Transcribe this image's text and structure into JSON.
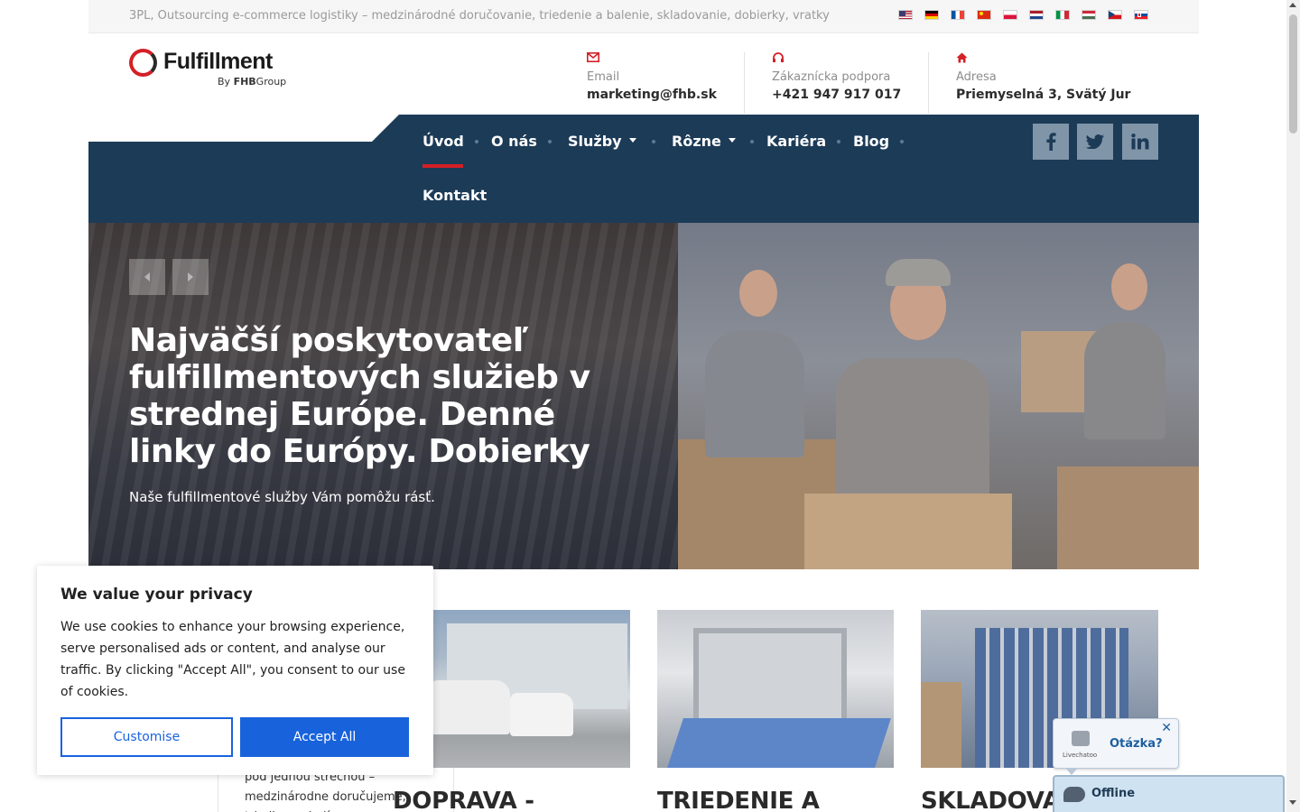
{
  "topbar": {
    "tagline": "3PL, Outsourcing e-commerce logistiky – medzinárodné doručovanie, triedenie a balenie, skladovanie, dobierky, vratky",
    "languages": [
      "en",
      "de",
      "fr",
      "zh",
      "pl",
      "nl",
      "it",
      "hu",
      "cs",
      "sk"
    ]
  },
  "logo": {
    "word": "Fulfillment",
    "by": "By",
    "group_bold": "FHB",
    "group": "Group"
  },
  "contacts": [
    {
      "icon": "envelope-icon",
      "label": "Email",
      "value": "marketing@fhb.sk"
    },
    {
      "icon": "headset-icon",
      "label": "Zákaznícka podpora",
      "value": "+421 947 917 017"
    },
    {
      "icon": "home-icon",
      "label": "Adresa",
      "value": "Priemyselná 3, Svätý Jur"
    }
  ],
  "nav": {
    "items": [
      "Úvod",
      "O nás",
      "Služby",
      "Rôzne",
      "Kariéra",
      "Blog",
      "Kontakt"
    ],
    "active": "Úvod"
  },
  "social": [
    "facebook-icon",
    "twitter-icon",
    "linkedin-icon"
  ],
  "hero": {
    "title": "Najväčší poskytovateľ fulfillmentových služieb v strednej Európe. Denné linky do Európy. Dobierky",
    "subtitle": "Naše fulfillmentové služby Vám pomôžu rásť."
  },
  "cards": {
    "left_text": "pod jednou strechou – medzinárodne doručujeme, triedime a balíme",
    "titles": [
      "DOPRAVA -",
      "TRIEDENIE A",
      "SKLADOVA"
    ]
  },
  "cookie": {
    "title": "We value your privacy",
    "body": "We use cookies to enhance your browsing experience, serve personalised ads or content, and analyse our traffic. By clicking \"Accept All\", you consent to our use of cookies.",
    "customise": "Customise",
    "accept": "Accept All"
  },
  "livechat": {
    "question": "Otázka?",
    "brand": "Livechatoo",
    "status": "Offline",
    "close": "✕"
  },
  "colors": {
    "brand_red": "#d42027",
    "nav_blue": "#1c3b57",
    "cookie_blue": "#1863dc"
  }
}
